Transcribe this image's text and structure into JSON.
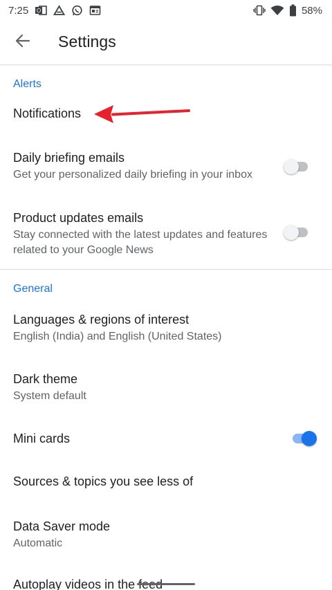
{
  "status_bar": {
    "time": "7:25",
    "battery": "58%",
    "icons": [
      "outlook-icon",
      "drive-icon",
      "whatsapp-icon",
      "news-icon",
      "vibrate-icon",
      "wifi-icon",
      "battery-icon"
    ]
  },
  "header": {
    "title": "Settings",
    "back_icon": "arrow-back-icon"
  },
  "sections": {
    "alerts": {
      "label": "Alerts",
      "notifications": {
        "title": "Notifications"
      },
      "daily_briefing": {
        "title": "Daily briefing emails",
        "subtitle": "Get your personalized daily briefing in your inbox",
        "enabled": false
      },
      "product_updates": {
        "title": "Product updates emails",
        "subtitle": "Stay connected with the latest updates and features related to your Google News",
        "enabled": false
      }
    },
    "general": {
      "label": "General",
      "languages": {
        "title": "Languages & regions of interest",
        "subtitle": "English (India) and English (United States)"
      },
      "dark_theme": {
        "title": "Dark theme",
        "subtitle": "System default"
      },
      "mini_cards": {
        "title": "Mini cards",
        "enabled": true
      },
      "sources_topics": {
        "title": "Sources & topics you see less of"
      },
      "data_saver": {
        "title": "Data Saver mode",
        "subtitle": "Automatic"
      },
      "autoplay": {
        "title": "Autoplay videos in the feed"
      }
    }
  },
  "annotation": {
    "arrow_color": "#e8212e",
    "points_to": "Notifications"
  },
  "colors": {
    "accent": "#1a73e8",
    "switch_off": "#bdc1c6",
    "switch_on_track": "#8ab4f8"
  }
}
